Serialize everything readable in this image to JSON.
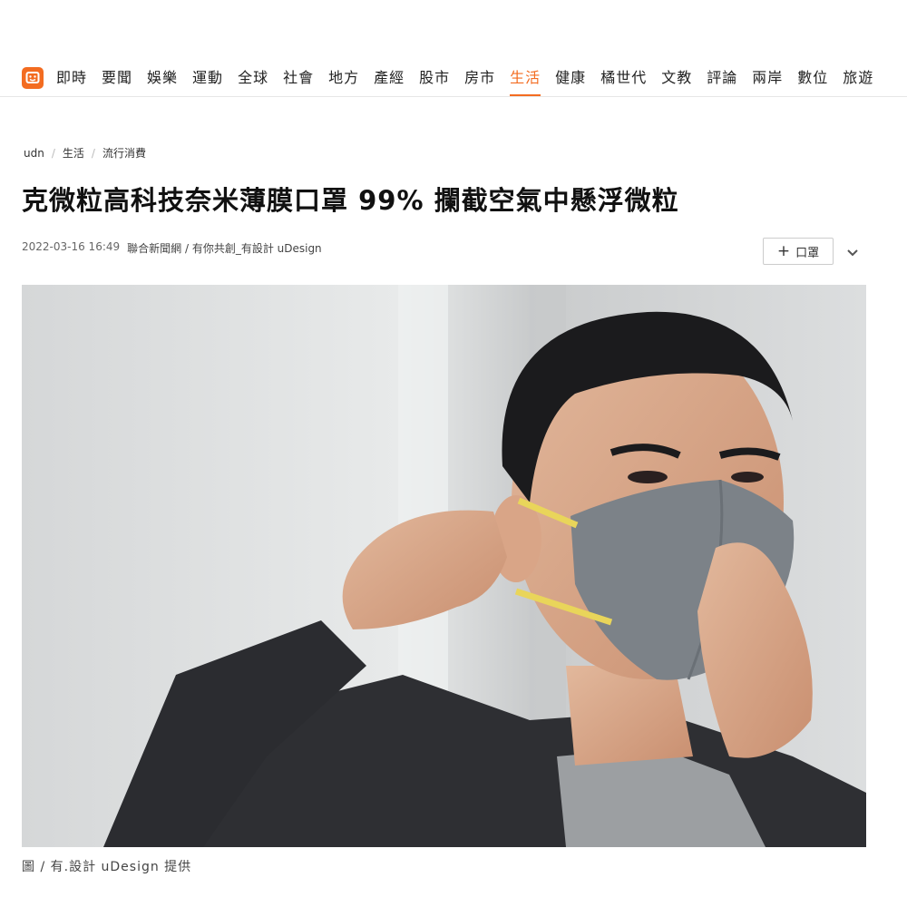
{
  "nav": {
    "items": [
      "即時",
      "要聞",
      "娛樂",
      "運動",
      "全球",
      "社會",
      "地方",
      "產經",
      "股市",
      "房市",
      "生活",
      "健康",
      "橘世代",
      "文教",
      "評論",
      "兩岸",
      "數位",
      "旅遊"
    ],
    "active": "生活",
    "accent": "#f36c21"
  },
  "breadcrumb": {
    "items": [
      "udn",
      "生活",
      "流行消費"
    ],
    "separator": "/"
  },
  "article": {
    "title": "克微粒高科技奈米薄膜口罩 99% 攔截空氣中懸浮微粒",
    "datetime": "2022-03-16 16:49",
    "source": "聯合新聞網 / 有你共創_有設計 uDesign",
    "tag_button": "口罩",
    "image_caption": "圖 / 有.設計 uDesign 提供"
  },
  "icons": {
    "logo": "udn-logo-icon",
    "plus": "plus-icon",
    "expand": "chevron-down-icon"
  }
}
